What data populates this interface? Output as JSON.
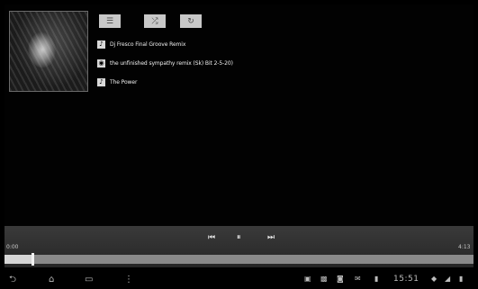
{
  "album": {
    "caption": ""
  },
  "toggles": {
    "playlist_icon": "list-icon",
    "shuffle_icon": "shuffle-icon",
    "repeat_icon": "repeat-icon"
  },
  "track": {
    "artist": "Dj Fresco Final Groove Remix",
    "title": "the unfinished sympathy remix (Sk) Bit 2-5-20)",
    "album": "The Power"
  },
  "player": {
    "elapsed": "0:00",
    "total": "4:13",
    "progress_percent": 6,
    "prev_symbol": "⏮",
    "pause_symbol": "⏸",
    "next_symbol": "⏭"
  },
  "system": {
    "time": "15:51",
    "nav": {
      "back": "⮌",
      "home": "⌂",
      "recents": "▭",
      "menu": "⋮"
    }
  }
}
